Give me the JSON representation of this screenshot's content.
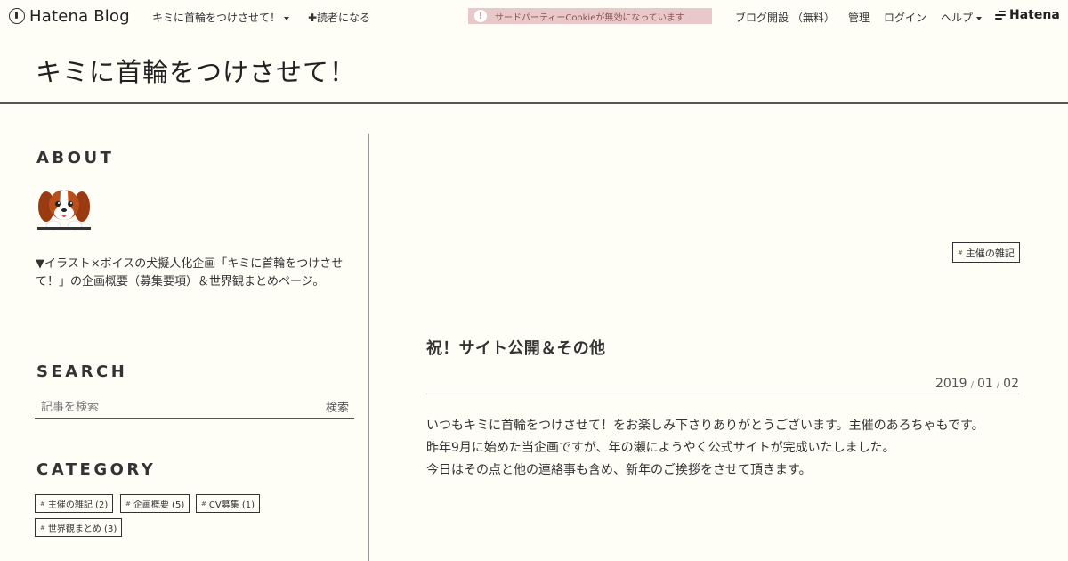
{
  "globalheader": {
    "logo_text": "Hatena Blog",
    "blog_menu": "キミに首輪をつけさせて！",
    "subscribe": "✚読者になる",
    "cookie_warning": "サードパーティーCookieが無効になっています",
    "cookie_bang": "!",
    "open_blog": "ブログ開設 （無料）",
    "admin": "管理",
    "login": "ログイン",
    "help": "ヘルプ",
    "hatena_brand": "Hatena"
  },
  "blog": {
    "title": "キミに首輪をつけさせて！"
  },
  "sidebar": {
    "about": {
      "heading": "ABOUT",
      "text": "▼イラスト×ボイスの犬擬人化企画「キミに首輪をつけさせて！」の企画概要（募集要項）＆世界観まとめページ。"
    },
    "search": {
      "heading": "SEARCH",
      "placeholder": "記事を検索",
      "button": "検索"
    },
    "category": {
      "heading": "CATEGORY",
      "tags": [
        {
          "label": "主催の雑記 (2)"
        },
        {
          "label": "企画概要 (5)"
        },
        {
          "label": "CV募集 (1)"
        },
        {
          "label": "世界観まとめ (3)"
        }
      ]
    }
  },
  "entry": {
    "category": "主催の雑記",
    "title": "祝！サイト公開＆その他",
    "date": {
      "year": "2019",
      "month": "01",
      "day": "02",
      "sep": "/"
    },
    "body": [
      "いつもキミに首輪をつけさせて！をお楽しみ下さりありがとうございます。主催のあろちゃもです。",
      "昨年9月に始めた当企画ですが、年の瀬にようやく公式サイトが完成いたしました。",
      "今日はその点と他の連絡事も含め、新年のご挨拶をさせて頂きます。"
    ]
  },
  "hash_symbol": "#",
  "colors": {
    "background": "#fefdf6",
    "text": "#333333",
    "cookie_warning_bg": "#e8c8c8"
  },
  "icons": {
    "logo": "hatena-pen-icon",
    "caret": "caret-down-icon",
    "avatar": "dog-avatar"
  }
}
